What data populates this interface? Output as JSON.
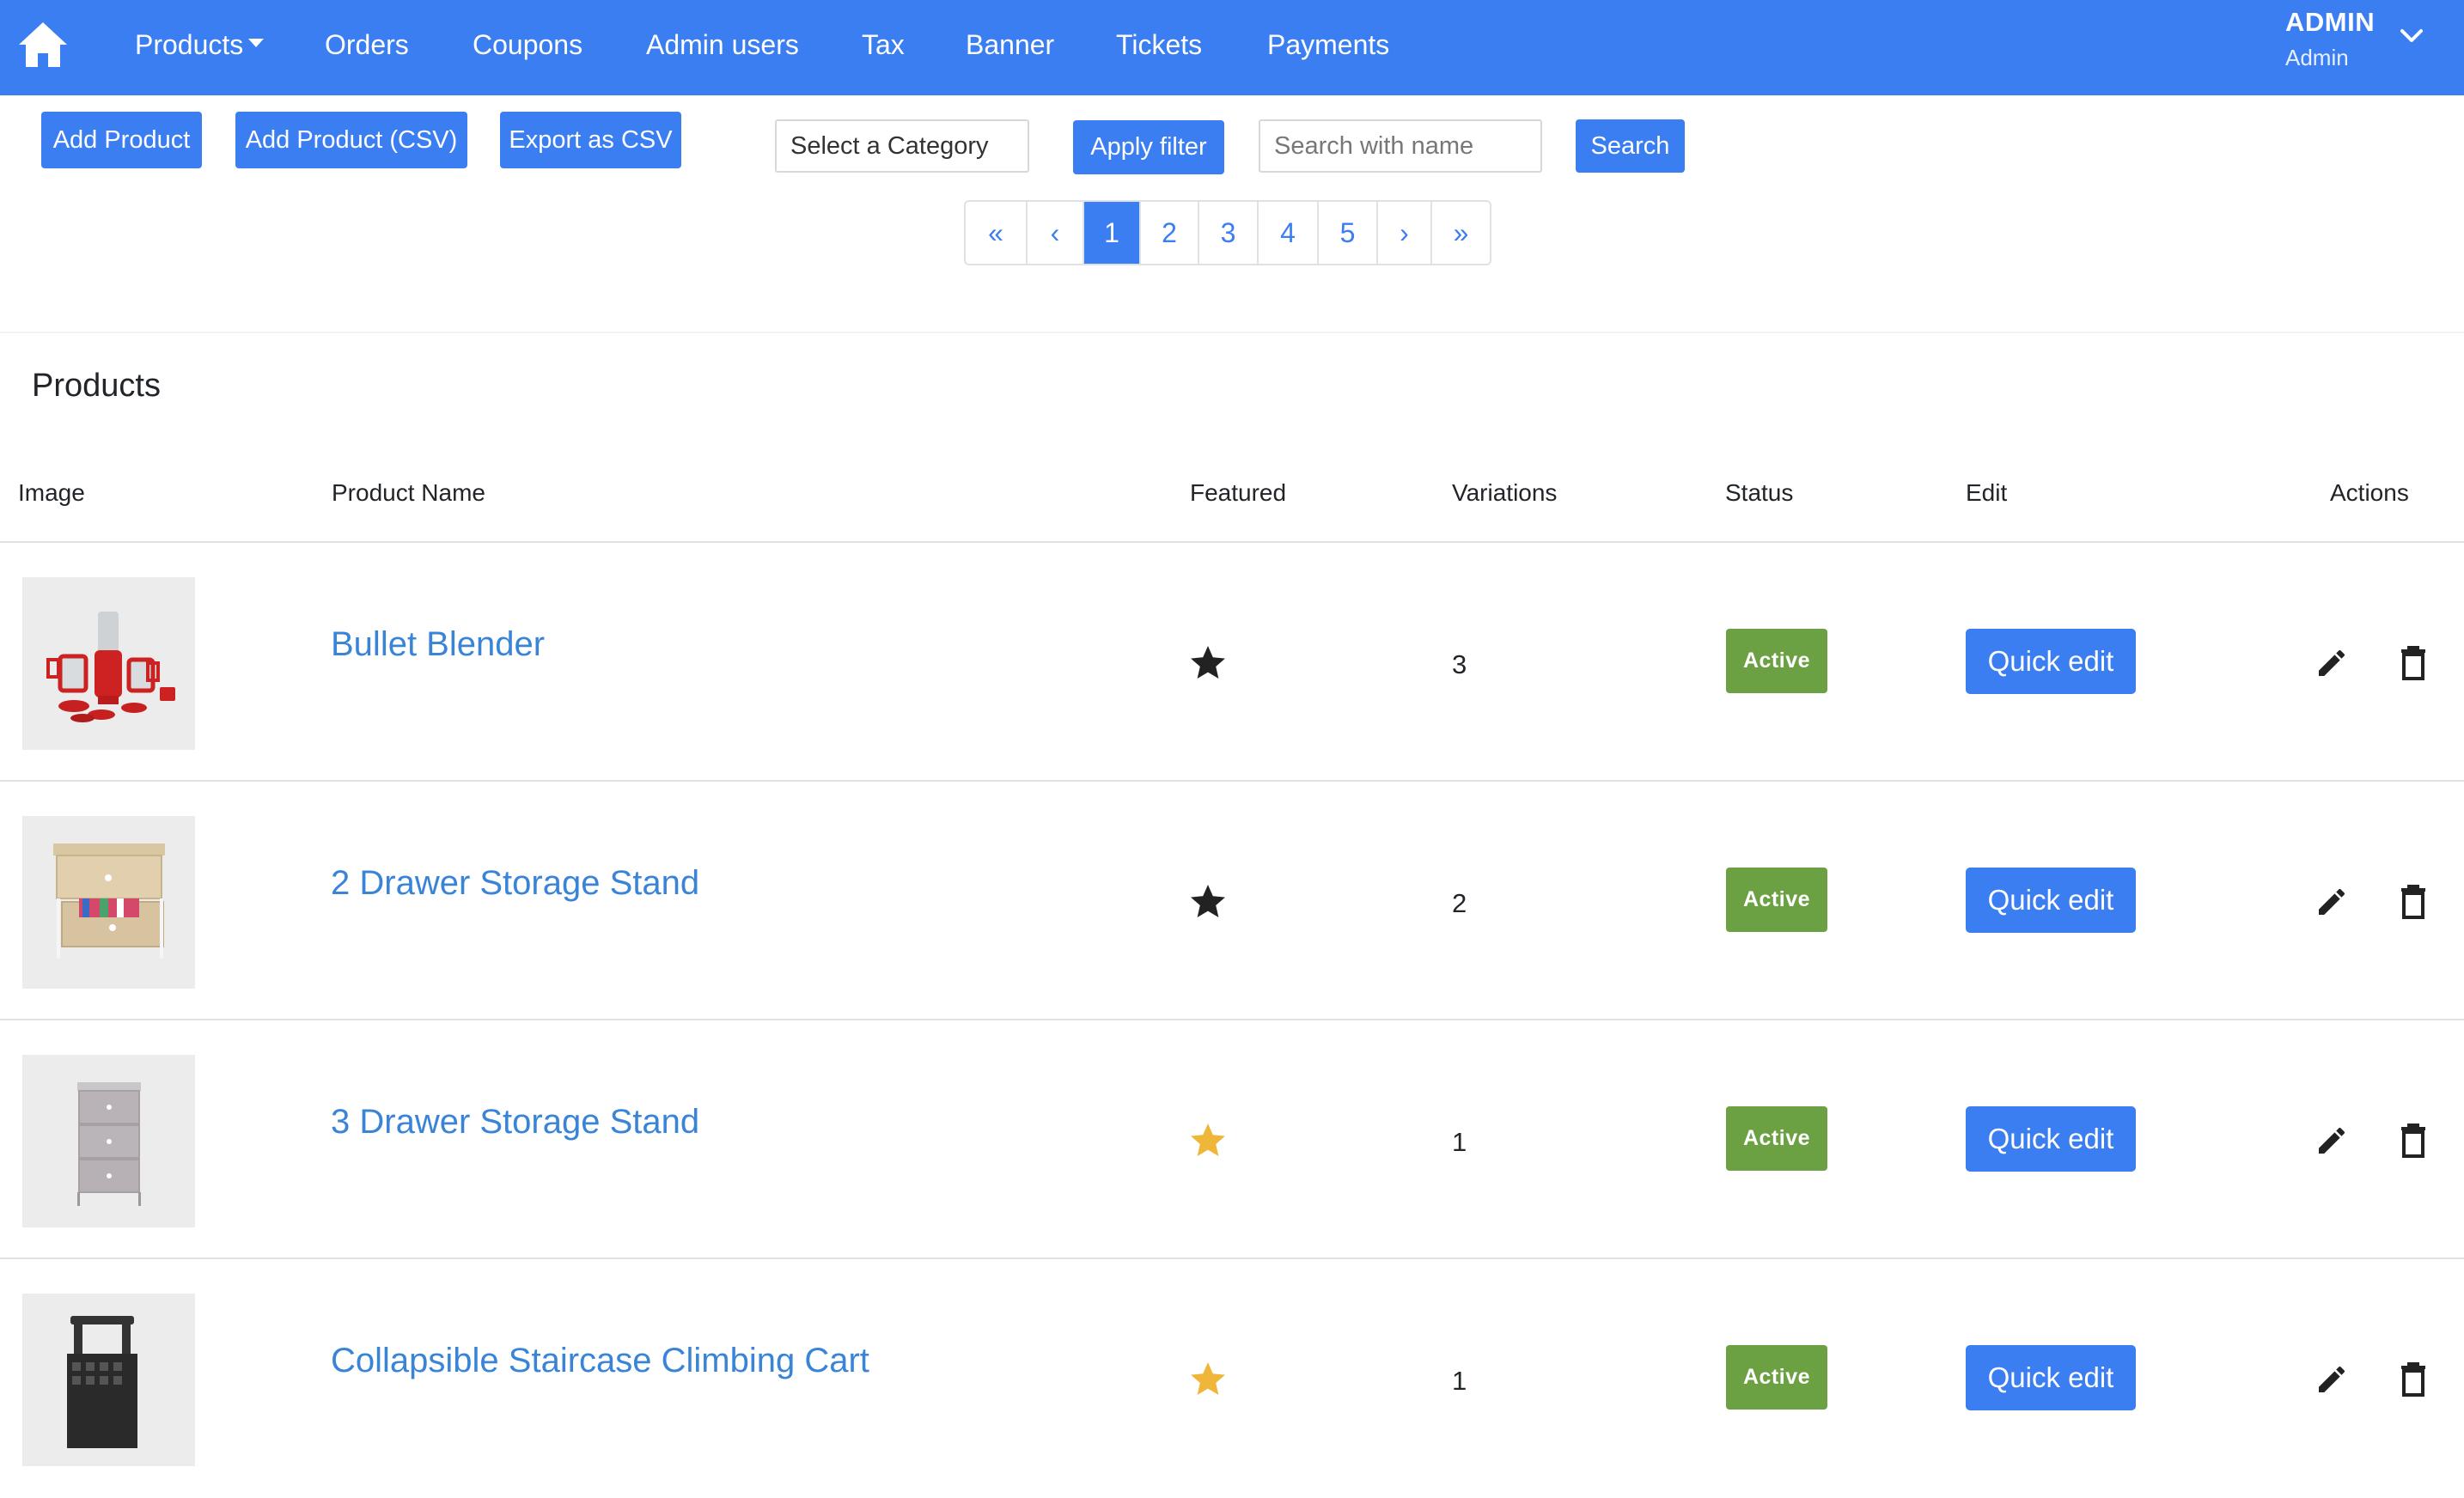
{
  "nav": {
    "home_icon": "home-icon",
    "items": [
      "Products",
      "Orders",
      "Coupons",
      "Admin users",
      "Tax",
      "Banner",
      "Tickets",
      "Payments"
    ],
    "user": {
      "name": "ADMIN",
      "role": "Admin"
    }
  },
  "toolbar": {
    "add_product": "Add Product",
    "add_product_csv": "Add Product (CSV)",
    "export_csv": "Export as CSV",
    "category_select": "Select a Category",
    "apply_filter": "Apply filter",
    "search_placeholder": "Search with name",
    "search_button": "Search"
  },
  "pagination": {
    "first": "«",
    "prev": "‹",
    "pages": [
      "1",
      "2",
      "3",
      "4",
      "5"
    ],
    "current": "1",
    "next": "›",
    "last": "»"
  },
  "section_title": "Products",
  "table": {
    "headers": [
      "Image",
      "Product Name",
      "Featured",
      "Variations",
      "Status",
      "Edit",
      "Actions"
    ],
    "rows": [
      {
        "name": "Bullet Blender",
        "featured_icon": "star-filled-dark-icon",
        "variations": "3",
        "status": "Active",
        "edit": "Quick edit"
      },
      {
        "name": "2 Drawer Storage Stand",
        "featured_icon": "star-filled-dark-icon",
        "variations": "2",
        "status": "Active",
        "edit": "Quick edit"
      },
      {
        "name": "3 Drawer Storage Stand",
        "featured_icon": "star-filled-gold-icon",
        "variations": "1",
        "status": "Active",
        "edit": "Quick edit"
      },
      {
        "name": "Collapsible Staircase Climbing Cart",
        "featured_icon": "star-filled-gold-icon",
        "variations": "1",
        "status": "Active",
        "edit": "Quick edit"
      }
    ]
  },
  "colors": {
    "primary": "#3a7ef2",
    "link": "#3a84d8",
    "success": "#6ba043",
    "star_dark": "#222222",
    "star_gold": "#f0b63a"
  }
}
